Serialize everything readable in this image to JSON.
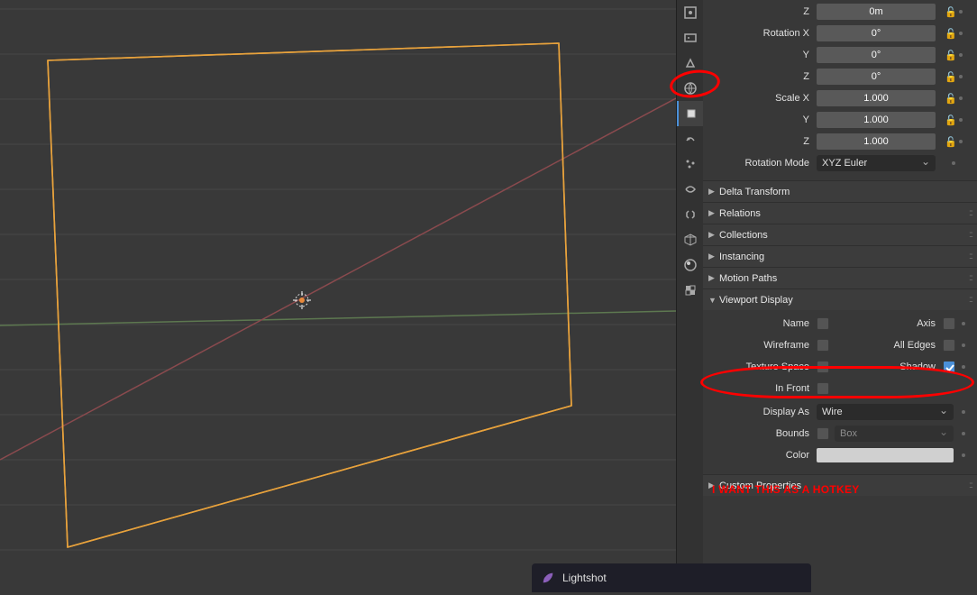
{
  "transforms": {
    "loc_z": {
      "label": "Z",
      "value": "0m"
    },
    "rot_x": {
      "label": "Rotation X",
      "value": "0°"
    },
    "rot_y": {
      "label": "Y",
      "value": "0°"
    },
    "rot_z": {
      "label": "Z",
      "value": "0°"
    },
    "scale_x": {
      "label": "Scale X",
      "value": "1.000"
    },
    "scale_y": {
      "label": "Y",
      "value": "1.000"
    },
    "scale_z": {
      "label": "Z",
      "value": "1.000"
    },
    "rot_mode": {
      "label": "Rotation Mode",
      "value": "XYZ Euler"
    }
  },
  "sections": {
    "delta": "Delta Transform",
    "relations": "Relations",
    "collections": "Collections",
    "instancing": "Instancing",
    "motion": "Motion Paths",
    "viewport": "Viewport Display",
    "custom": "Custom Properties"
  },
  "viewport_display": {
    "name": {
      "label_l": "Name",
      "label_r": "Axis"
    },
    "wireframe": {
      "label_l": "Wireframe",
      "label_r": "All Edges"
    },
    "texture": {
      "label_l": "Texture Space",
      "label_r": "Shadow"
    },
    "infront": {
      "label_l": "In Front"
    },
    "display_as": {
      "label": "Display As",
      "value": "Wire"
    },
    "bounds": {
      "label": "Bounds",
      "value": "Box"
    },
    "color": {
      "label": "Color"
    }
  },
  "annotations": {
    "hotkey": "I WANT THIS AS A HOTKEY"
  },
  "lightshot": {
    "title": "Lightshot"
  }
}
